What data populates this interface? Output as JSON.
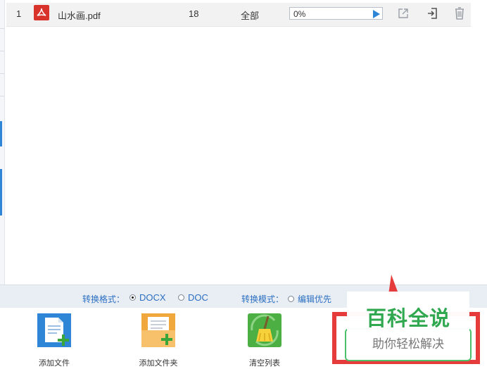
{
  "file_list": {
    "rows": [
      {
        "index": "1",
        "name": "山水画.pdf",
        "pages": "18",
        "range": "全部",
        "progress_text": "0%",
        "progress": 0
      }
    ]
  },
  "options": {
    "format_label": "转换格式：",
    "format_options": [
      "DOCX",
      "DOC"
    ],
    "format_selected": "DOCX",
    "mode_label": "转换模式：",
    "mode_option": "编辑优先"
  },
  "toolbar": {
    "add_file": "添加文件",
    "add_folder": "添加文件夹",
    "clear_list": "清空列表"
  },
  "watermark": {
    "title": "百科全说",
    "subtitle": "助你轻松解决"
  },
  "colors": {
    "accent": "#2f86d6",
    "link_text": "#2b6fc2",
    "pdf_red": "#d9342b",
    "watermark_green": "#2fa84f",
    "highlight_red": "#e53b3b"
  }
}
